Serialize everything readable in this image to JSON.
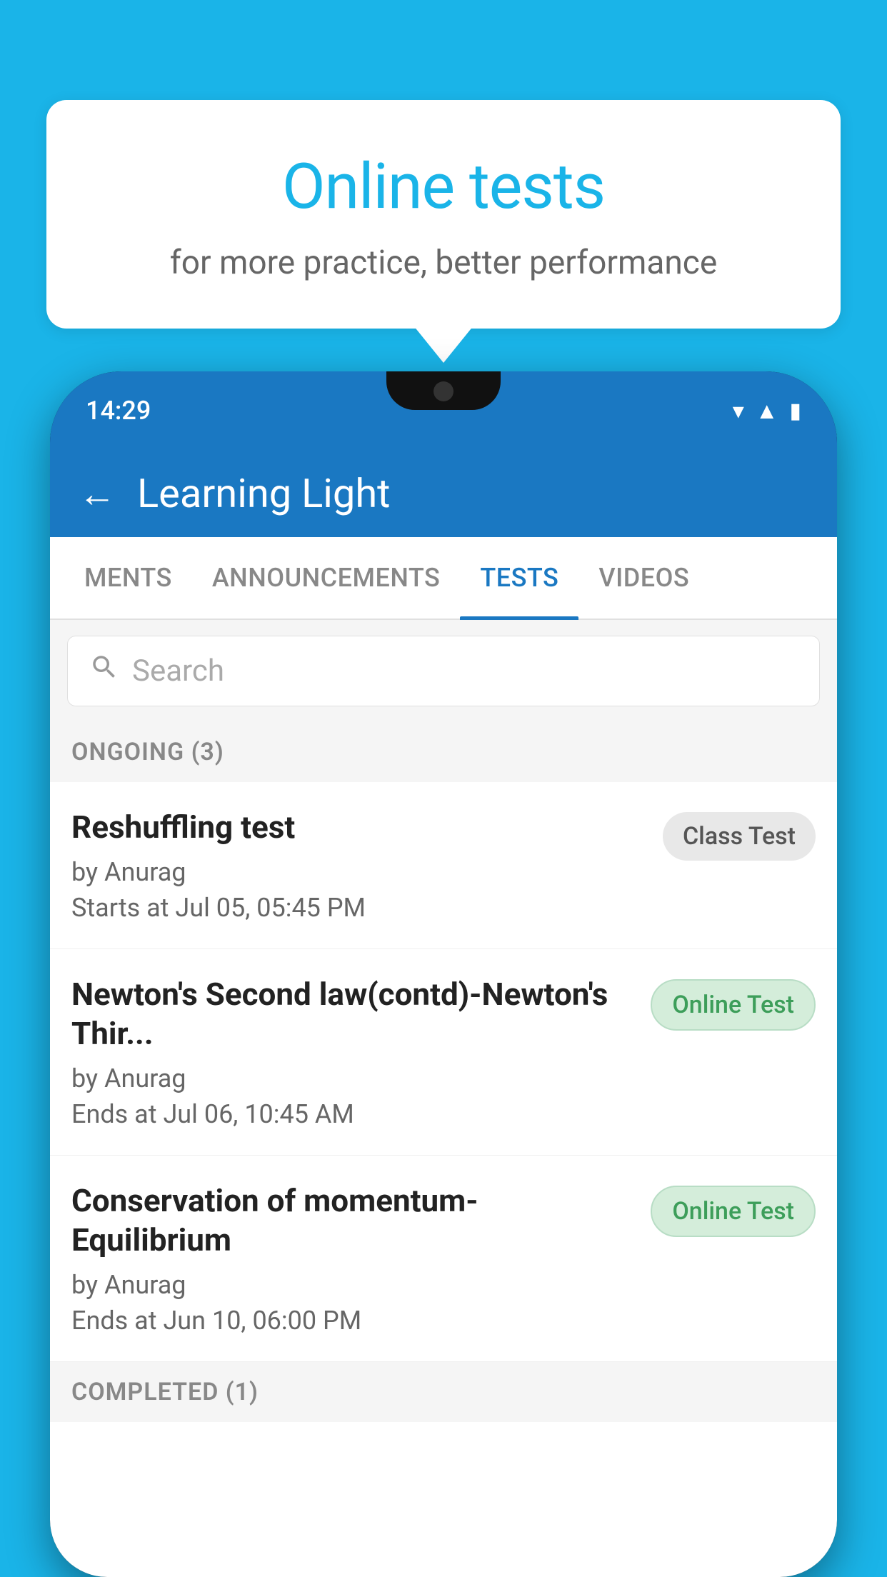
{
  "background": {
    "color": "#1ab4e8"
  },
  "speechBubble": {
    "title": "Online tests",
    "subtitle": "for more practice, better performance"
  },
  "phone": {
    "statusBar": {
      "time": "14:29",
      "icons": [
        "wifi",
        "signal",
        "battery"
      ]
    },
    "appHeader": {
      "title": "Learning Light",
      "backLabel": "←"
    },
    "tabs": [
      {
        "label": "MENTS",
        "active": false
      },
      {
        "label": "ANNOUNCEMENTS",
        "active": false
      },
      {
        "label": "TESTS",
        "active": true
      },
      {
        "label": "VIDEOS",
        "active": false
      }
    ],
    "search": {
      "placeholder": "Search"
    },
    "ongoingSection": {
      "label": "ONGOING (3)",
      "tests": [
        {
          "name": "Reshuffling test",
          "by": "by Anurag",
          "time": "Starts at  Jul 05, 05:45 PM",
          "badge": "Class Test",
          "badgeType": "class"
        },
        {
          "name": "Newton's Second law(contd)-Newton's Thir...",
          "by": "by Anurag",
          "time": "Ends at  Jul 06, 10:45 AM",
          "badge": "Online Test",
          "badgeType": "online"
        },
        {
          "name": "Conservation of momentum-Equilibrium",
          "by": "by Anurag",
          "time": "Ends at  Jun 10, 06:00 PM",
          "badge": "Online Test",
          "badgeType": "online"
        }
      ]
    },
    "completedSection": {
      "label": "COMPLETED (1)"
    }
  }
}
